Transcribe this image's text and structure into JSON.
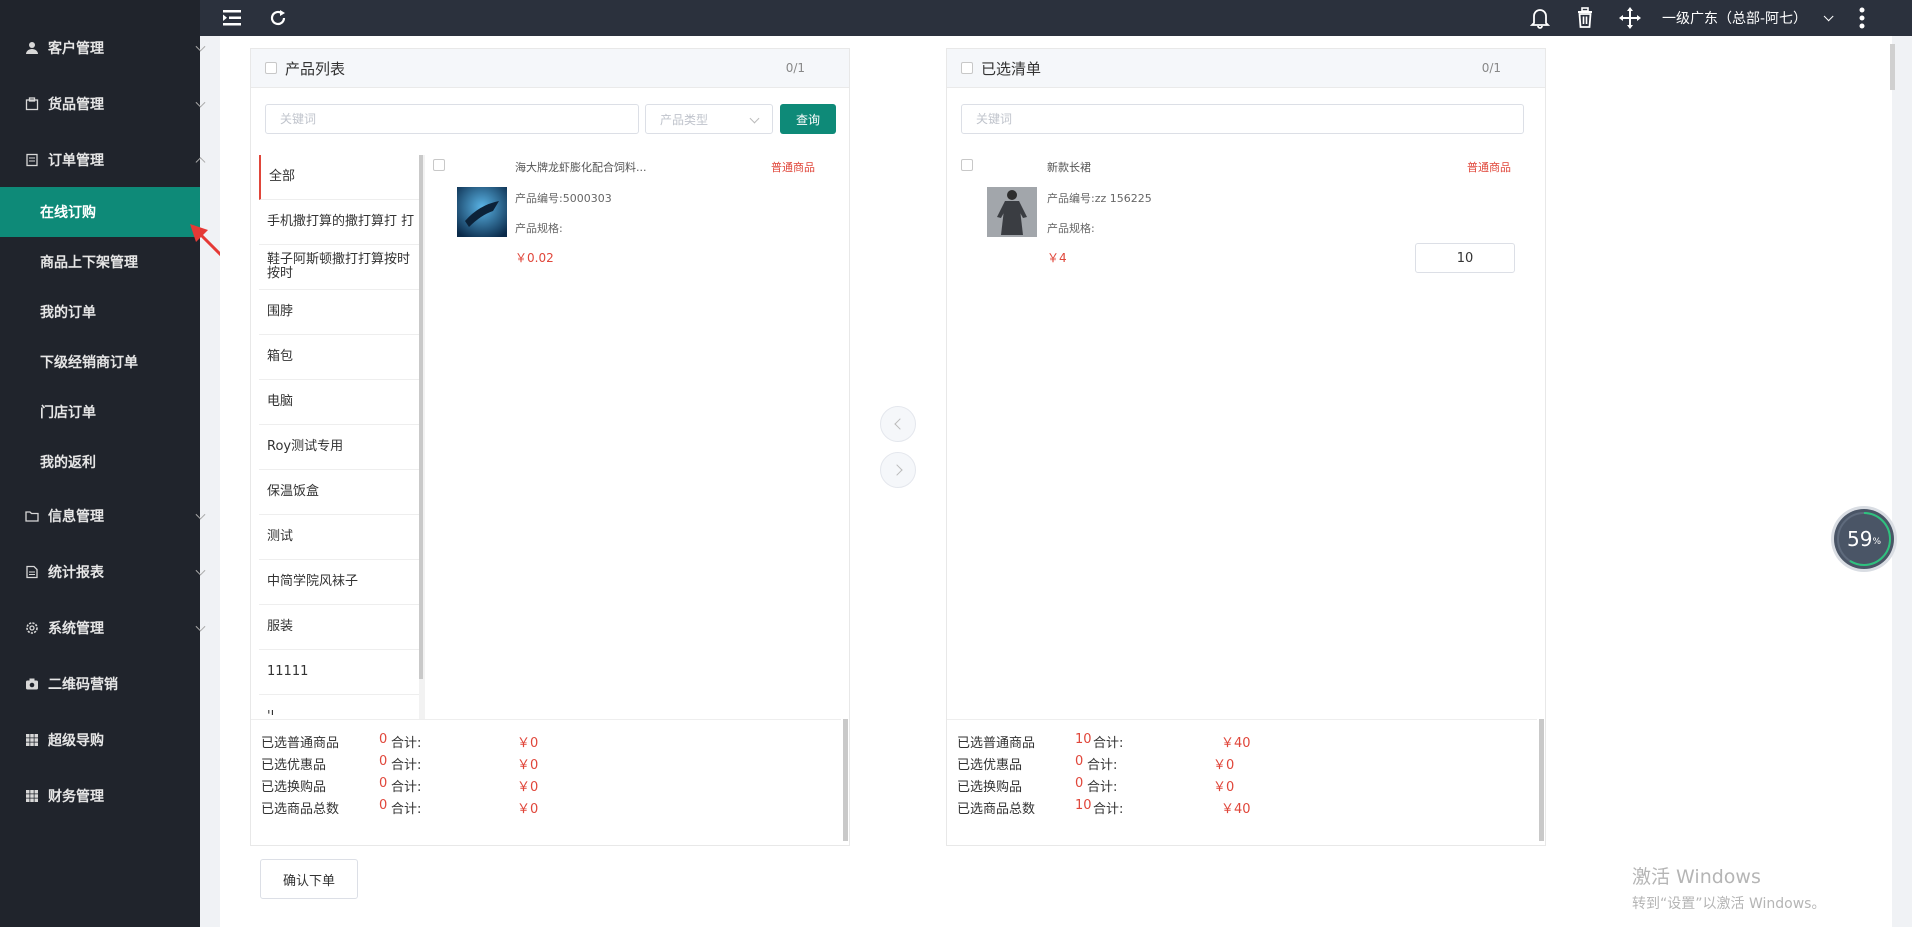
{
  "sidebar": {
    "items": [
      {
        "label": "客户管理",
        "icon": "user-icon"
      },
      {
        "label": "货品管理",
        "icon": "box-icon"
      },
      {
        "label": "订单管理",
        "icon": "order-icon"
      },
      {
        "label": "信息管理",
        "icon": "folder-icon"
      },
      {
        "label": "统计报表",
        "icon": "report-icon"
      },
      {
        "label": "系统管理",
        "icon": "gear-icon"
      },
      {
        "label": "二维码营销",
        "icon": "camera-icon"
      },
      {
        "label": "超级导购",
        "icon": "grid-icon"
      },
      {
        "label": "财务管理",
        "icon": "grid-icon"
      }
    ],
    "order_sub_items": [
      {
        "label": "在线订购",
        "active": true
      },
      {
        "label": "商品上下架管理"
      },
      {
        "label": "我的订单"
      },
      {
        "label": "下级经销商订单"
      },
      {
        "label": "门店订单"
      },
      {
        "label": "我的返利"
      }
    ],
    "active_color": "#0e8a78"
  },
  "topbar": {
    "user": "一级广东（总部-阿七）"
  },
  "left_panel": {
    "title": "产品列表",
    "count": "0/1",
    "keyword_placeholder": "关键词",
    "type_placeholder": "产品类型",
    "query_button": "查询",
    "categories": [
      "全部",
      "手机撒打算的撒打算打 打",
      "鞋子阿斯顿撒打打算按时按时",
      "围脖",
      "箱包",
      "电脑",
      "Roy测试专用",
      "保温饭盒",
      "测试",
      "中简学院风袜子",
      "服装",
      "11111",
      "'l"
    ],
    "product": {
      "name": "海大牌龙虾膨化配合饲料...",
      "tag": "普通商品",
      "code": "产品编号:5000303",
      "spec": "产品规格:",
      "price": "￥0.02"
    },
    "summary": [
      {
        "label": "已选普通商品",
        "count": "0",
        "total_label": "合计:",
        "total": "￥0"
      },
      {
        "label": "已选优惠品",
        "count": "0",
        "total_label": "合计:",
        "total": "￥0"
      },
      {
        "label": "已选换购品",
        "count": "0",
        "total_label": "合计:",
        "total": "￥0"
      },
      {
        "label": "已选商品总数",
        "count": "0",
        "total_label": "合计:",
        "total": "￥0"
      }
    ]
  },
  "right_panel": {
    "title": "已选清单",
    "count": "0/1",
    "keyword_placeholder": "关键词",
    "product": {
      "name": "新款长裙",
      "tag": "普通商品",
      "code": "产品编号:zz 156225",
      "spec": "产品规格:",
      "price": "￥4",
      "quantity": "10"
    },
    "summary": [
      {
        "label": "已选普通商品",
        "count": "10",
        "total_label": "合计:",
        "total": "￥40"
      },
      {
        "label": "已选优惠品",
        "count": "0",
        "total_label": "合计:",
        "total": "￥0"
      },
      {
        "label": "已选换购品",
        "count": "0",
        "total_label": "合计:",
        "total": "￥0"
      },
      {
        "label": "已选商品总数",
        "count": "10",
        "total_label": "合计:",
        "total": "￥40"
      }
    ]
  },
  "confirm_button": "确认下单",
  "gauge": {
    "value": "59",
    "unit": "%"
  },
  "watermark": {
    "line1": "激活 Windows",
    "line2": "转到“设置”以激活 Windows。"
  }
}
